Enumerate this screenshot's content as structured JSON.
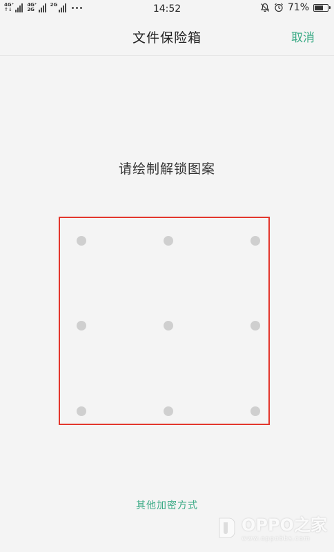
{
  "status_bar": {
    "network_1": "4G⁺",
    "network_1_sub": "↑↓",
    "network_2": "4G⁺",
    "network_2_sub": "2G",
    "network_3": "2G",
    "time": "14:52",
    "battery_percent": "71%",
    "battery_level": 0.71,
    "icons": [
      "mute-bell-icon",
      "alarm-icon",
      "battery-icon"
    ]
  },
  "header": {
    "title": "文件保险箱",
    "cancel_label": "取消",
    "accent_color": "#3aaa85"
  },
  "main": {
    "prompt": "请绘制解锁图案",
    "pattern_grid": {
      "rows": 3,
      "cols": 3,
      "dot_color": "#cfcfcf",
      "highlight_color": "#e3362c"
    },
    "other_methods_label": "其他加密方式"
  },
  "watermark": {
    "brand": "OPPO之家",
    "url": "www.oppobbs.com"
  }
}
